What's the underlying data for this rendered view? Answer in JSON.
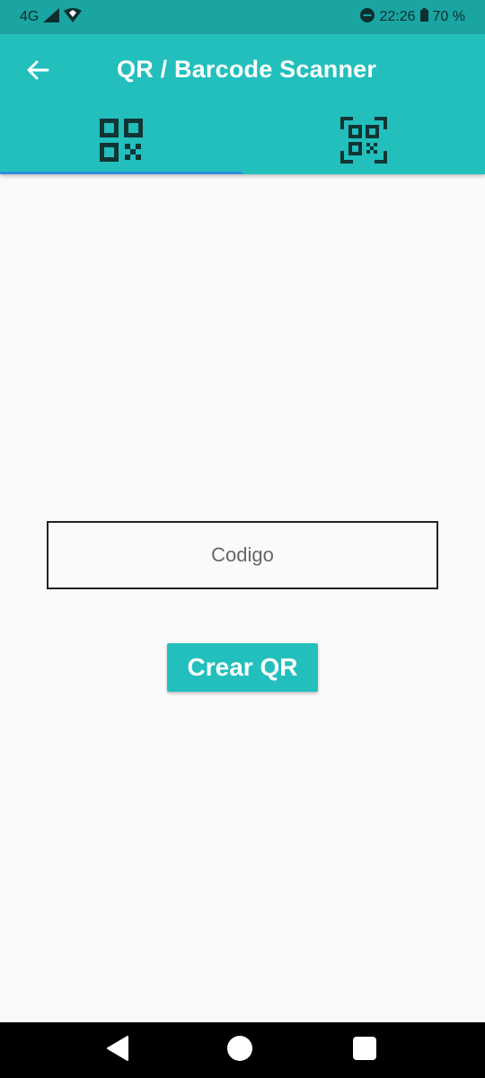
{
  "status_bar": {
    "network": "4G",
    "time": "22:26",
    "battery": "70 %",
    "icons": [
      "signal-icon",
      "wifi-icon",
      "dnd-icon",
      "battery-icon"
    ]
  },
  "app_bar": {
    "title": "QR / Barcode Scanner",
    "back_icon": "arrow-left-icon",
    "tabs": [
      {
        "icon": "qr-code-icon",
        "selected": true
      },
      {
        "icon": "qr-scan-icon",
        "selected": false
      }
    ]
  },
  "form": {
    "code_placeholder": "Codigo",
    "code_value": "",
    "create_button_label": "Crear QR"
  },
  "nav_bar": {
    "buttons": [
      "back-triangle-icon",
      "home-circle-icon",
      "recents-square-icon"
    ]
  },
  "colors": {
    "primary": "#22bfbd",
    "status_bar": "#1aa4a2",
    "tab_indicator": "#2d8fd8",
    "background": "#fafafa"
  }
}
